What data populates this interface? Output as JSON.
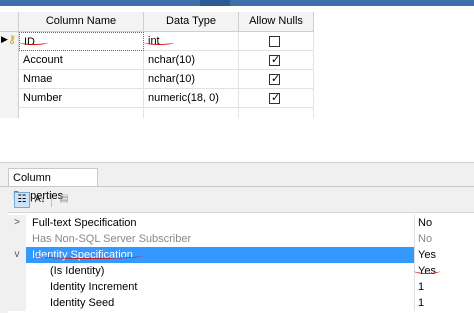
{
  "grid": {
    "headers": [
      "Column Name",
      "Data Type",
      "Allow Nulls"
    ],
    "rows": [
      {
        "name": "ID",
        "type": "int",
        "allow_nulls": false,
        "is_key": true
      },
      {
        "name": "Account",
        "type": "nchar(10)",
        "allow_nulls": true,
        "is_key": false
      },
      {
        "name": "Nmae",
        "type": "nchar(10)",
        "allow_nulls": true,
        "is_key": false
      },
      {
        "name": "Number",
        "type": "numeric(18, 0)",
        "allow_nulls": true,
        "is_key": false
      }
    ],
    "check_glyph": "✓"
  },
  "panel": {
    "tab_label": "Column Properties",
    "properties": [
      {
        "expander": ">",
        "name": "Full-text Specification",
        "value": "No",
        "grayed": false,
        "selected": false,
        "indent": 0
      },
      {
        "expander": "",
        "name": "Has Non-SQL Server Subscriber",
        "value": "No",
        "grayed": true,
        "selected": false,
        "indent": 0
      },
      {
        "expander": "v",
        "name": "Identity Specification",
        "value": "Yes",
        "grayed": false,
        "selected": true,
        "indent": 0
      },
      {
        "expander": "",
        "name": "(Is Identity)",
        "value": "Yes",
        "grayed": false,
        "selected": false,
        "indent": 1
      },
      {
        "expander": "",
        "name": "Identity Increment",
        "value": "1",
        "grayed": false,
        "selected": false,
        "indent": 1
      },
      {
        "expander": "",
        "name": "Identity Seed",
        "value": "1",
        "grayed": false,
        "selected": false,
        "indent": 1
      }
    ]
  },
  "colors": {
    "selection": "#3399ff",
    "annotation": "#d01010",
    "key_icon": "#c9a400"
  }
}
